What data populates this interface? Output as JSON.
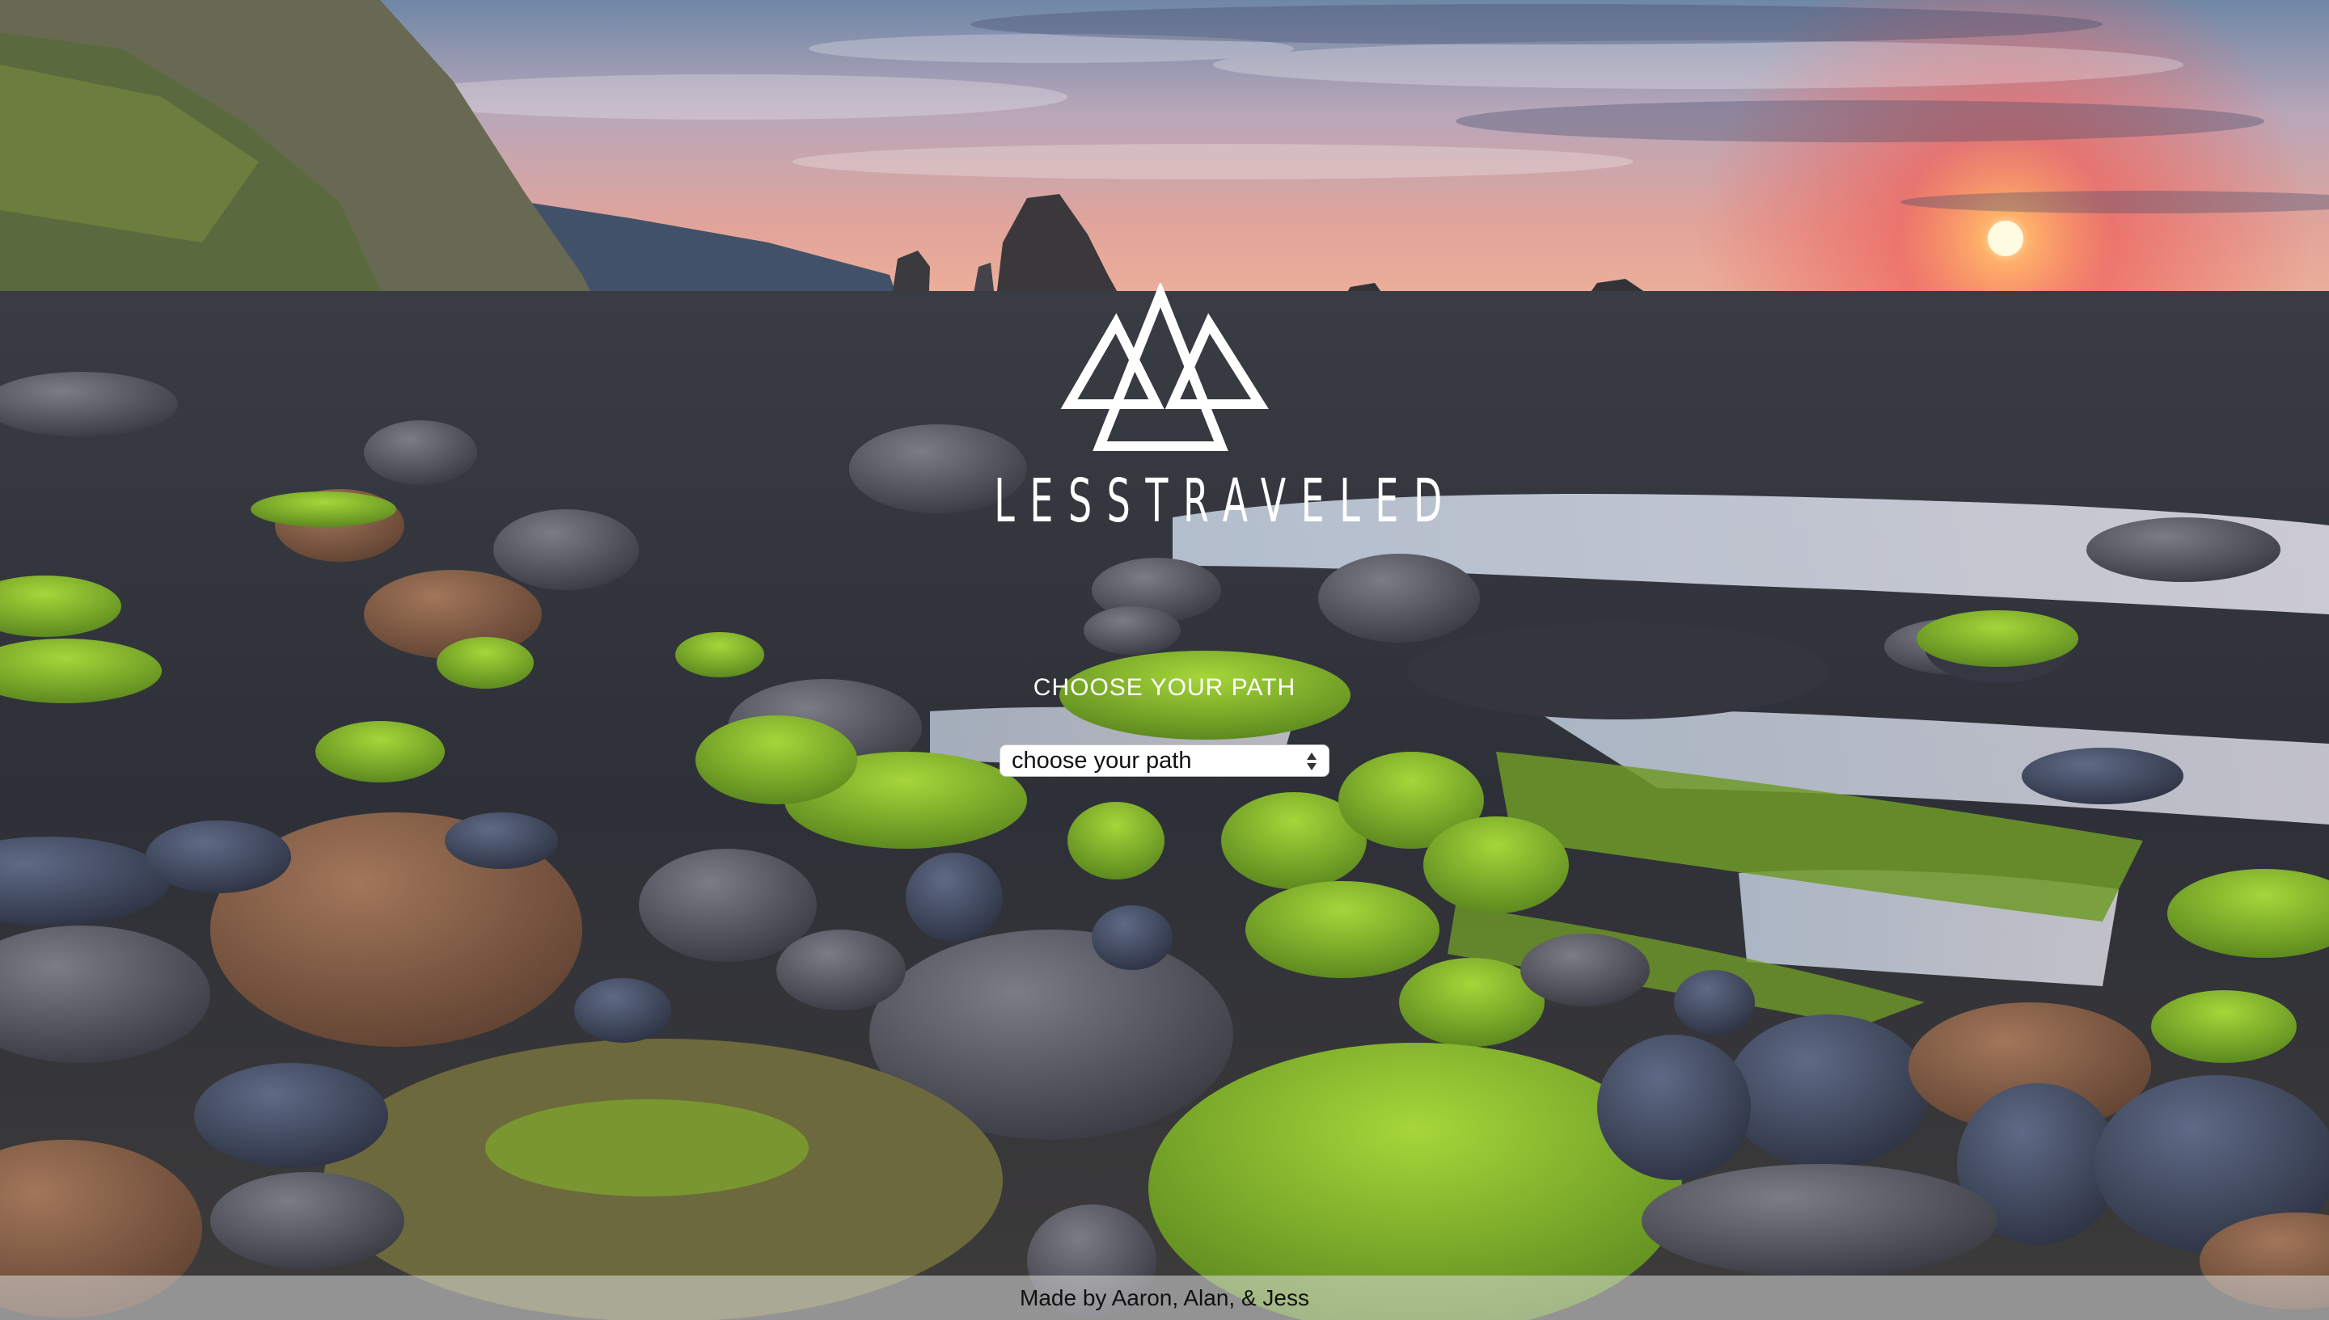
{
  "brand": {
    "name": "LESSTRAVELED",
    "logo_icon": "triple-triangle-mountain-icon"
  },
  "path_picker": {
    "heading": "CHOOSE YOUR PATH",
    "selected": "choose your path"
  },
  "footer": {
    "credits": "Made by Aaron, Alan, & Jess"
  },
  "background": {
    "icon": "rocky-beach-sunset-photo"
  }
}
